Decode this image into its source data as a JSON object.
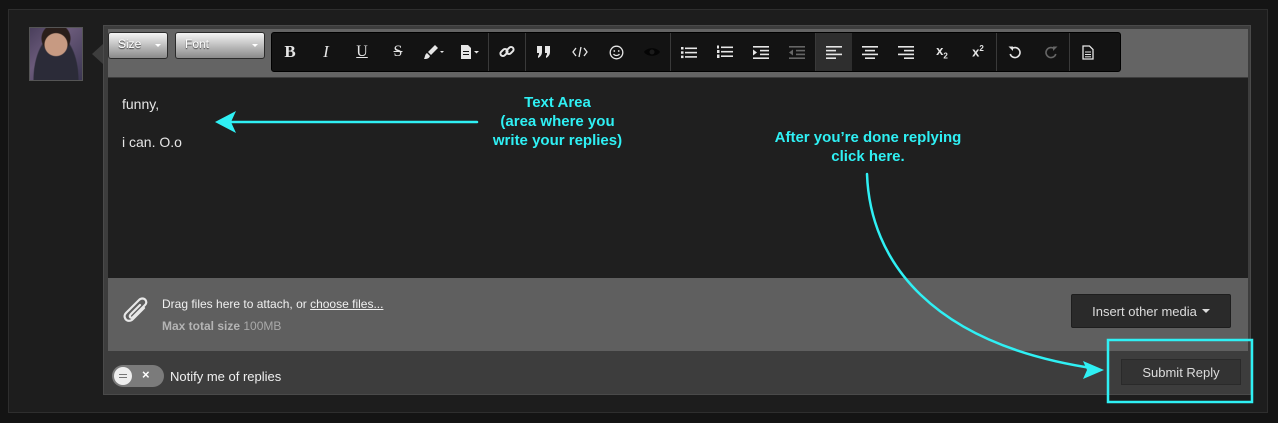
{
  "toolbar": {
    "size_label": "Size",
    "font_label": "Font",
    "buttons": {
      "bold": "B",
      "italic": "I",
      "underline": "U",
      "strike": "S",
      "subscript": "x",
      "subscript_mark": "2",
      "superscript": "x",
      "superscript_mark": "2"
    }
  },
  "editor": {
    "content_line1": "funny,",
    "content_line2": "i can. O.o"
  },
  "attachments": {
    "drag_text": "Drag files here to attach, or ",
    "choose_link": "choose files...",
    "max_label": "Max total size",
    "max_value": "100MB",
    "insert_media_label": "Insert other media"
  },
  "footer": {
    "notify_label": "Notify me of replies",
    "submit_label": "Submit Reply",
    "toggle_off_glyph": "×"
  },
  "annotations": {
    "text_area_note": "Text Area\n(area where you\nwrite your replies)",
    "submit_note": "After you’re done replying\nclick here."
  },
  "colors": {
    "annotation": "#2ff0f4",
    "editor_bg": "#1f1f1f",
    "toolbar_bg": "#131313"
  }
}
